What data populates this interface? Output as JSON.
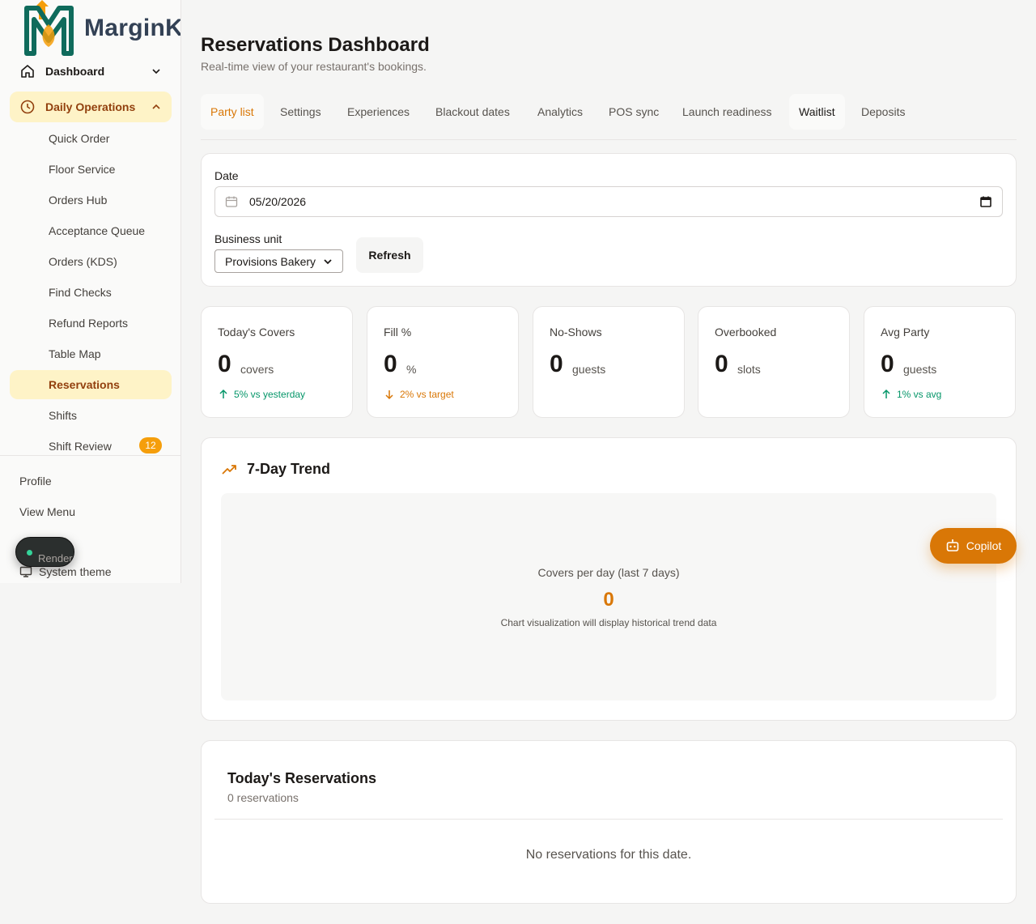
{
  "brand": {
    "name": "MarginK"
  },
  "sidebar": {
    "dashboard": "Dashboard",
    "group": "Daily Operations",
    "items": [
      {
        "label": "Quick Order"
      },
      {
        "label": "Floor Service"
      },
      {
        "label": "Orders Hub"
      },
      {
        "label": "Acceptance Queue"
      },
      {
        "label": "Orders (KDS)"
      },
      {
        "label": "Find Checks"
      },
      {
        "label": "Refund Reports"
      },
      {
        "label": "Table Map"
      },
      {
        "label": "Reservations",
        "active": true
      },
      {
        "label": "Shifts"
      },
      {
        "label": "Shift Review",
        "badge": "12"
      }
    ],
    "profile": "Profile",
    "view_menu": "View Menu",
    "theme": "System theme",
    "render_label": "Render"
  },
  "page": {
    "title": "Reservations Dashboard",
    "subtitle": "Real-time view of your restaurant's bookings."
  },
  "tabs": [
    "Party list",
    "Settings",
    "Experiences",
    "Blackout dates",
    "Analytics",
    "POS sync",
    "Launch readiness",
    "Waitlist",
    "Deposits"
  ],
  "filters": {
    "date_label": "Date",
    "date_value": "05/20/2026",
    "unit_label": "Business unit",
    "unit_value": "Provisions Bakery",
    "refresh": "Refresh"
  },
  "stats": [
    {
      "label": "Today's Covers",
      "value": "0",
      "unit": "covers",
      "delta": "5% vs yesterday",
      "direction": "up"
    },
    {
      "label": "Fill %",
      "value": "0",
      "unit": "%",
      "delta": "2% vs target",
      "direction": "down"
    },
    {
      "label": "No-Shows",
      "value": "0",
      "unit": "guests"
    },
    {
      "label": "Overbooked",
      "value": "0",
      "unit": "slots"
    },
    {
      "label": "Avg Party",
      "value": "0",
      "unit": "guests",
      "delta": "1% vs avg",
      "direction": "up"
    }
  ],
  "trend": {
    "title": "7-Day Trend",
    "caption": "Covers per day (last 7 days)",
    "value": "0",
    "note": "Chart visualization will display historical trend data"
  },
  "copilot": "Copilot",
  "reservations": {
    "title": "Today's Reservations",
    "count": "0 reservations",
    "empty": "No reservations for this date."
  },
  "colors": {
    "accent": "#d97706",
    "accent_soft": "#fef3c7",
    "positive": "#059669",
    "brand_teal": "#0f6b5c"
  }
}
